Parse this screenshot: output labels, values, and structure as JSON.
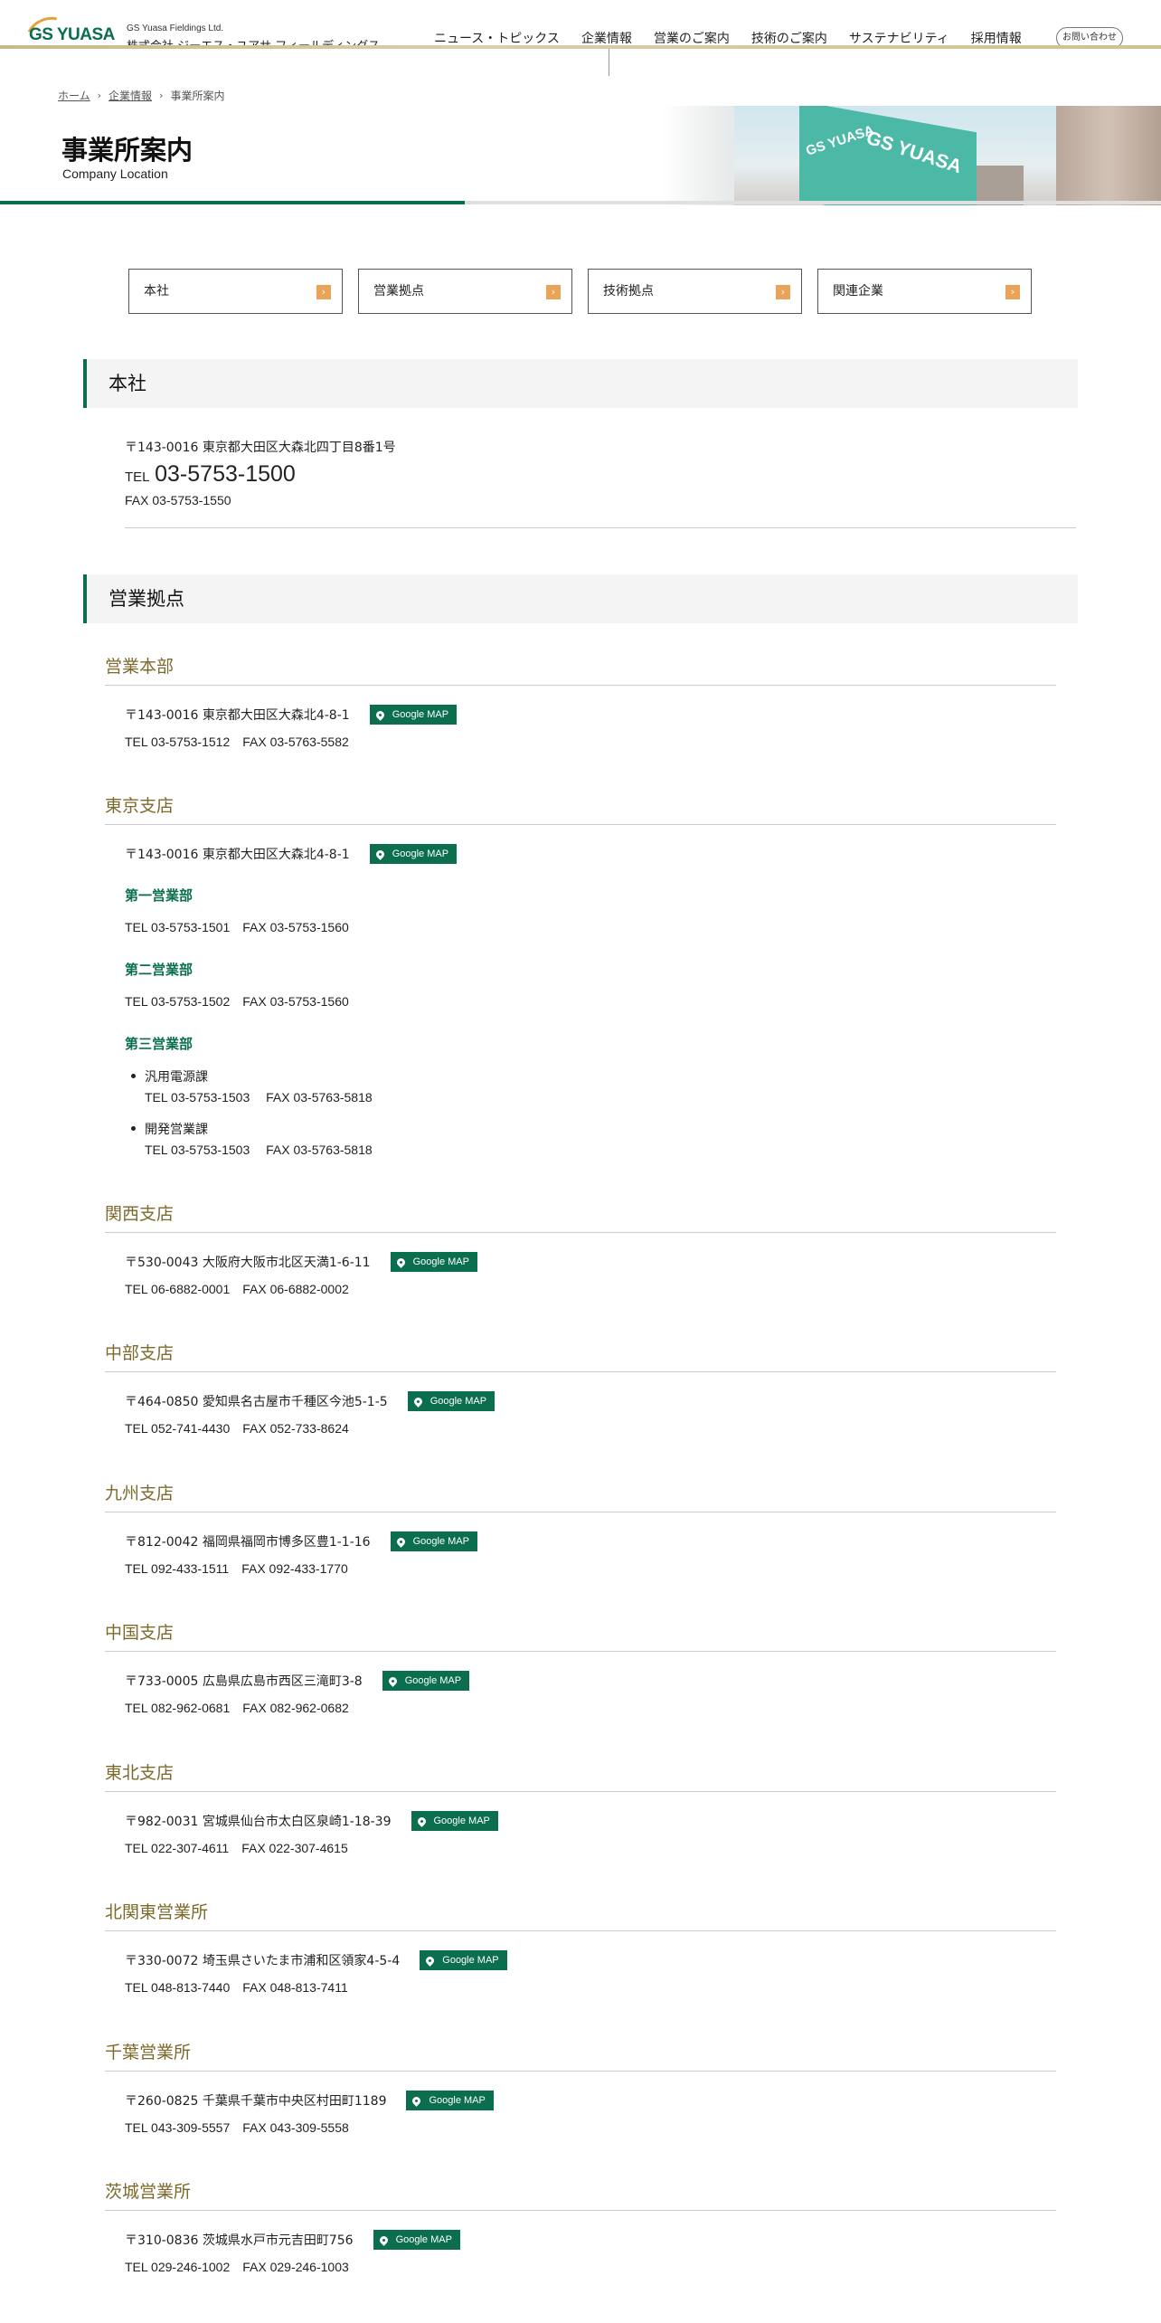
{
  "header": {
    "logo_text": "GS YUASA",
    "company_en": "GS Yuasa Fieldings Ltd.",
    "company_jp": "株式会社 ジーエス・ユアサ フィールディングス",
    "nav": [
      "ニュース・トピックス",
      "企業情報",
      "営業のご案内",
      "技術のご案内",
      "サステナビリティ",
      "採用情報"
    ],
    "contact": "お問い合わせ"
  },
  "breadcrumb": [
    "ホーム",
    "企業情報",
    "事業所案内"
  ],
  "page": {
    "title": "事業所案内",
    "subtitle": "Company Location"
  },
  "hero": {
    "sign1": "GS YUASA",
    "sign2": "GS YUASA"
  },
  "anchors": [
    "本社",
    "営業拠点",
    "技術拠点",
    "関連企業"
  ],
  "anchor_arrow": "›",
  "hq": {
    "heading": "本社",
    "address": "〒143-0016 東京都大田区大森北四丁目8番1号",
    "tel_label": "TEL",
    "tel": "03-5753-1500",
    "fax": "FAX 03-5753-1550"
  },
  "sales": {
    "heading": "営業拠点",
    "gmap_label": "Google MAP",
    "branches": [
      {
        "name": "営業本部",
        "address": "〒143-0016 東京都大田区大森北4-8-1",
        "tel": "TEL 03-5753-1512",
        "fax": "FAX 03-5763-5582"
      },
      {
        "name": "東京支店",
        "address": "〒143-0016 東京都大田区大森北4-8-1"
      },
      {
        "name": "関西支店",
        "address": "〒530-0043 大阪府大阪市北区天満1-6-11",
        "tel": "TEL 06-6882-0001",
        "fax": "FAX 06-6882-0002"
      },
      {
        "name": "中部支店",
        "address": "〒464-0850 愛知県名古屋市千種区今池5-1-5",
        "tel": "TEL 052-741-4430",
        "fax": "FAX 052-733-8624"
      },
      {
        "name": "九州支店",
        "address": "〒812-0042 福岡県福岡市博多区豊1-1-16",
        "tel": "TEL 092-433-1511",
        "fax": "FAX 092-433-1770"
      },
      {
        "name": "中国支店",
        "address": "〒733-0005 広島県広島市西区三滝町3-8",
        "tel": "TEL 082-962-0681",
        "fax": "FAX 082-962-0682"
      },
      {
        "name": "東北支店",
        "address": "〒982-0031 宮城県仙台市太白区泉崎1-18-39",
        "tel": "TEL 022-307-4611",
        "fax": "FAX 022-307-4615"
      },
      {
        "name": "北関東営業所",
        "address": "〒330-0072 埼玉県さいたま市浦和区領家4-5-4",
        "tel": "TEL 048-813-7440",
        "fax": "FAX 048-813-7411"
      },
      {
        "name": "千葉営業所",
        "address": "〒260-0825 千葉県千葉市中央区村田町1189",
        "tel": "TEL 043-309-5557",
        "fax": "FAX 043-309-5558"
      },
      {
        "name": "茨城営業所",
        "address": "〒310-0836 茨城県水戸市元吉田町756",
        "tel": "TEL 029-246-1002",
        "fax": "FAX 029-246-1003"
      }
    ],
    "tokyo_depts": [
      {
        "name": "第一営業部",
        "tel": "TEL 03-5753-1501",
        "fax": "FAX 03-5753-1560"
      },
      {
        "name": "第二営業部",
        "tel": "TEL 03-5753-1502",
        "fax": "FAX 03-5753-1560"
      },
      {
        "name": "第三営業部"
      }
    ],
    "tokyo_sections": [
      {
        "name": "汎用電源課",
        "tel": "TEL 03-5753-1503",
        "fax": "FAX 03-5763-5818"
      },
      {
        "name": "開発営業課",
        "tel": "TEL 03-5753-1503",
        "fax": "FAX 03-5763-5818"
      }
    ]
  },
  "colors": {
    "brand_green": "#0b6e4f",
    "branch_title": "#7c6a2c",
    "anchor_arrow": "#e9a45a",
    "header_line": "#cfc192"
  }
}
